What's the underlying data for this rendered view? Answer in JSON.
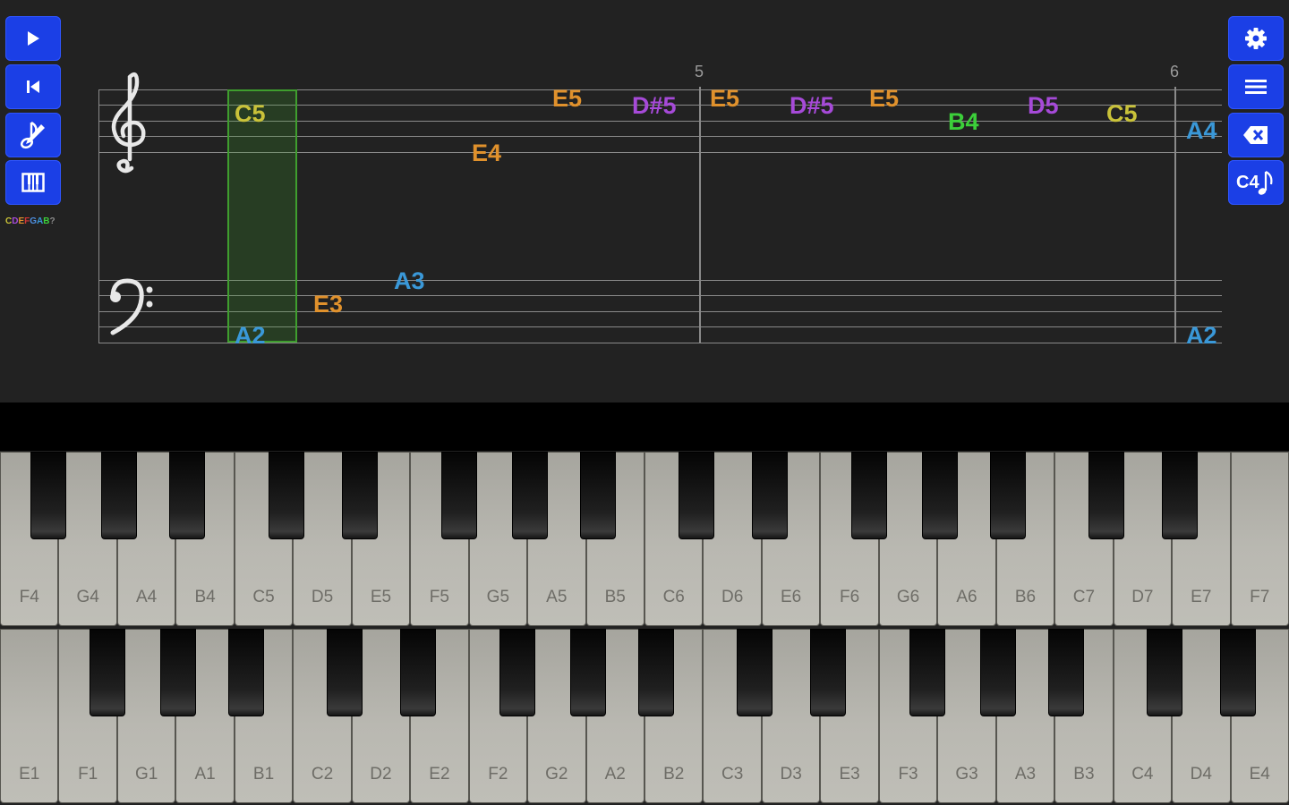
{
  "toolbar_left": [
    {
      "name": "play-button",
      "icon": "play-icon"
    },
    {
      "name": "rewind-button",
      "icon": "skip-back-icon"
    },
    {
      "name": "edit-note-button",
      "icon": "note-edit-icon"
    },
    {
      "name": "keyboard-button",
      "icon": "piano-icon"
    }
  ],
  "toolbar_right": [
    {
      "name": "settings-button",
      "icon": "gear-icon"
    },
    {
      "name": "list-button",
      "icon": "list-icon"
    },
    {
      "name": "delete-button",
      "icon": "backspace-icon"
    },
    {
      "name": "c4-note-button",
      "icon": "c4-note-icon",
      "label": "C4"
    }
  ],
  "note_legend": [
    {
      "letter": "C",
      "color": "#c9c239"
    },
    {
      "letter": "D",
      "color": "#a64ad8"
    },
    {
      "letter": "E",
      "color": "#e0912c"
    },
    {
      "letter": "F",
      "color": "#d13636"
    },
    {
      "letter": "G",
      "color": "#4f8fe0"
    },
    {
      "letter": "A",
      "color": "#3a98d8"
    },
    {
      "letter": "B",
      "color": "#3ccf3a"
    },
    {
      "letter": "?",
      "color": "#8a8a8a"
    }
  ],
  "measure_numbers": [
    "5",
    "6"
  ],
  "treble_notes": [
    {
      "label": "C5",
      "color": "#c9c239"
    },
    {
      "label": "E4",
      "color": "#e0912c"
    },
    {
      "label": "E5",
      "color": "#e0912c"
    },
    {
      "label": "D#5",
      "color": "#a64ad8"
    },
    {
      "label": "E5",
      "color": "#e0912c"
    },
    {
      "label": "D#5",
      "color": "#a64ad8"
    },
    {
      "label": "E5",
      "color": "#e0912c"
    },
    {
      "label": "B4",
      "color": "#3ccf3a"
    },
    {
      "label": "D5",
      "color": "#a64ad8"
    },
    {
      "label": "C5",
      "color": "#c9c239"
    },
    {
      "label": "A4",
      "color": "#3a98d8"
    }
  ],
  "bass_notes": [
    {
      "label": "A2",
      "color": "#3a98d8"
    },
    {
      "label": "E3",
      "color": "#e0912c"
    },
    {
      "label": "A3",
      "color": "#3a98d8"
    },
    {
      "label": "A2",
      "color": "#3a98d8"
    }
  ],
  "keyboard_upper": {
    "white_keys": [
      "F4",
      "G4",
      "A4",
      "B4",
      "C5",
      "D5",
      "E5",
      "F5",
      "G5",
      "A5",
      "B5",
      "C6",
      "D6",
      "E6",
      "F6",
      "G6",
      "A6",
      "B6",
      "C7",
      "D7",
      "E7",
      "F7"
    ]
  },
  "keyboard_lower": {
    "white_keys": [
      "E1",
      "F1",
      "G1",
      "A1",
      "B1",
      "C2",
      "D2",
      "E2",
      "F2",
      "G2",
      "A2",
      "B2",
      "C3",
      "D3",
      "E3",
      "F3",
      "G3",
      "A3",
      "B3",
      "C4",
      "D4",
      "E4"
    ]
  }
}
